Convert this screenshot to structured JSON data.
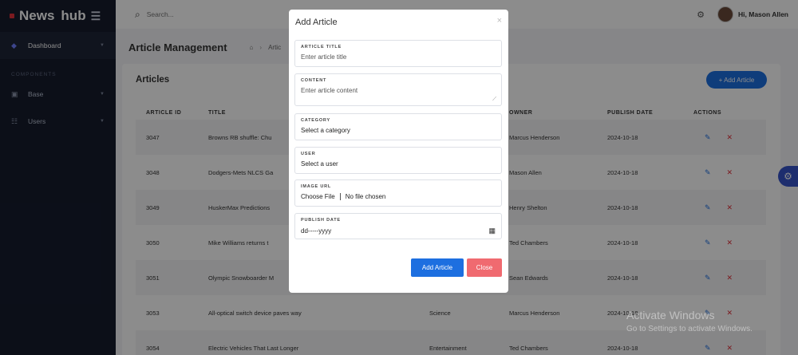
{
  "brand": {
    "name1": "News",
    "name2": "hub"
  },
  "sidebar": {
    "items": [
      {
        "label": "Dashboard",
        "icon": "palette-icon"
      },
      {
        "label": "Base",
        "icon": "box-icon"
      },
      {
        "label": "Users",
        "icon": "grid-icon"
      }
    ],
    "section_label": "COMPONENTS"
  },
  "topbar": {
    "search_placeholder": "Search...",
    "greeting": "Hi, Mason Allen"
  },
  "page": {
    "title": "Article Management",
    "crumb": "Artic"
  },
  "card": {
    "title": "Articles",
    "add_button": "+ Add Article"
  },
  "table": {
    "columns": [
      "ARTICLE ID",
      "TITLE",
      "",
      "OWNER",
      "PUBLISH DATE",
      "ACTIONS"
    ],
    "rows": [
      {
        "id": "3047",
        "title": "Browns RB shuffle: Chu",
        "category": "",
        "owner": "Marcus Henderson",
        "date": "2024-10-18"
      },
      {
        "id": "3048",
        "title": "Dodgers-Mets NLCS Ga",
        "category": "",
        "owner": "Mason Allen",
        "date": "2024-10-18"
      },
      {
        "id": "3049",
        "title": "HuskerMax Predictions",
        "category": "",
        "owner": "Henry Shelton",
        "date": "2024-10-18"
      },
      {
        "id": "3050",
        "title": "Mike Williams returns t",
        "category": "",
        "owner": "Ted Chambers",
        "date": "2024-10-18"
      },
      {
        "id": "3051",
        "title": "Olympic Snowboarder M",
        "category": "",
        "owner": "Sean Edwards",
        "date": "2024-10-18"
      },
      {
        "id": "3053",
        "title": "All-optical switch device paves way",
        "category": "Science",
        "owner": "Marcus Henderson",
        "date": "2024-10-18"
      },
      {
        "id": "3054",
        "title": "Electric Vehicles That Last Longer",
        "category": "Entertainment",
        "owner": "Ted Chambers",
        "date": "2024-10-18"
      }
    ]
  },
  "modal": {
    "title": "Add Article",
    "close_symbol": "×",
    "fields": {
      "title": {
        "label": "ARTICLE TITLE",
        "placeholder": "Enter article title"
      },
      "content": {
        "label": "CONTENT",
        "placeholder": "Enter article content"
      },
      "category": {
        "label": "CATEGORY",
        "value": "Select a category"
      },
      "user": {
        "label": "USER",
        "value": "Select a user"
      },
      "image": {
        "label": "IMAGE URL",
        "button": "Choose File",
        "status": "No file chosen"
      },
      "date": {
        "label": "PUBLISH DATE",
        "value": "dd-----yyyy"
      }
    },
    "add_button": "Add Article",
    "close_button": "Close"
  },
  "watermark": {
    "line1": "Activate Windows",
    "line2": "Go to Settings to activate Windows."
  },
  "colors": {
    "primary": "#1d6fe0",
    "danger": "#f06a70",
    "sidebar": "#161c2d"
  }
}
